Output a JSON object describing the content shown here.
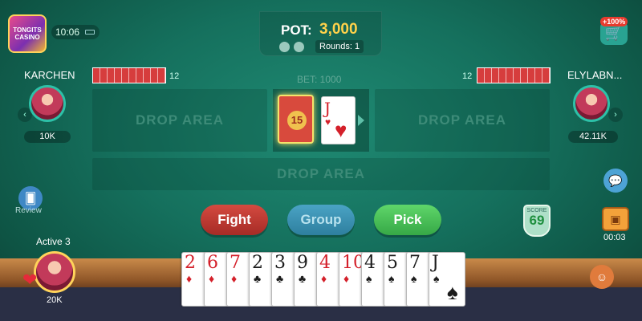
{
  "logo": {
    "text": "TONGITS CASINO"
  },
  "status": {
    "time": "10:06"
  },
  "pot": {
    "label": "POT:",
    "value": "3,000",
    "rounds": "Rounds: 1"
  },
  "shop": {
    "badge": "+100%"
  },
  "bet": {
    "label": "BET: 1000"
  },
  "players": {
    "left": {
      "name": "KARCHEN",
      "chips": "10K",
      "card_count": "12"
    },
    "right": {
      "name": "ELYLABN...",
      "chips": "42.11K",
      "card_count": "12"
    },
    "me": {
      "status": "Active 3",
      "chips": "20K"
    }
  },
  "table": {
    "drop_left": "DROP AREA",
    "drop_right": "DROP AREA",
    "drop_center": "DROP AREA",
    "stock_count": "15",
    "discard": {
      "rank": "J",
      "suit": "♥",
      "color": "red"
    }
  },
  "actions": {
    "fight": "Fight",
    "group": "Group",
    "pick": "Pick"
  },
  "score": {
    "label": "SCORE",
    "value": "69"
  },
  "review": {
    "label": "Review"
  },
  "timer": "00:03",
  "hand": [
    {
      "rank": "2",
      "suit": "♦",
      "color": "red"
    },
    {
      "rank": "6",
      "suit": "♦",
      "color": "red"
    },
    {
      "rank": "7",
      "suit": "♦",
      "color": "red"
    },
    {
      "rank": "2",
      "suit": "♣",
      "color": "black"
    },
    {
      "rank": "3",
      "suit": "♣",
      "color": "black"
    },
    {
      "rank": "9",
      "suit": "♣",
      "color": "black"
    },
    {
      "rank": "4",
      "suit": "♦",
      "color": "red"
    },
    {
      "rank": "10",
      "suit": "♦",
      "color": "red"
    },
    {
      "rank": "4",
      "suit": "♠",
      "color": "black"
    },
    {
      "rank": "5",
      "suit": "♠",
      "color": "black"
    },
    {
      "rank": "7",
      "suit": "♠",
      "color": "black"
    },
    {
      "rank": "J",
      "suit": "♠",
      "color": "black"
    }
  ],
  "colors": {
    "felt": "#15705d",
    "fight": "#c23a32",
    "group": "#3a92b4",
    "pick": "#46c256",
    "pot_value": "#ffd24a"
  }
}
